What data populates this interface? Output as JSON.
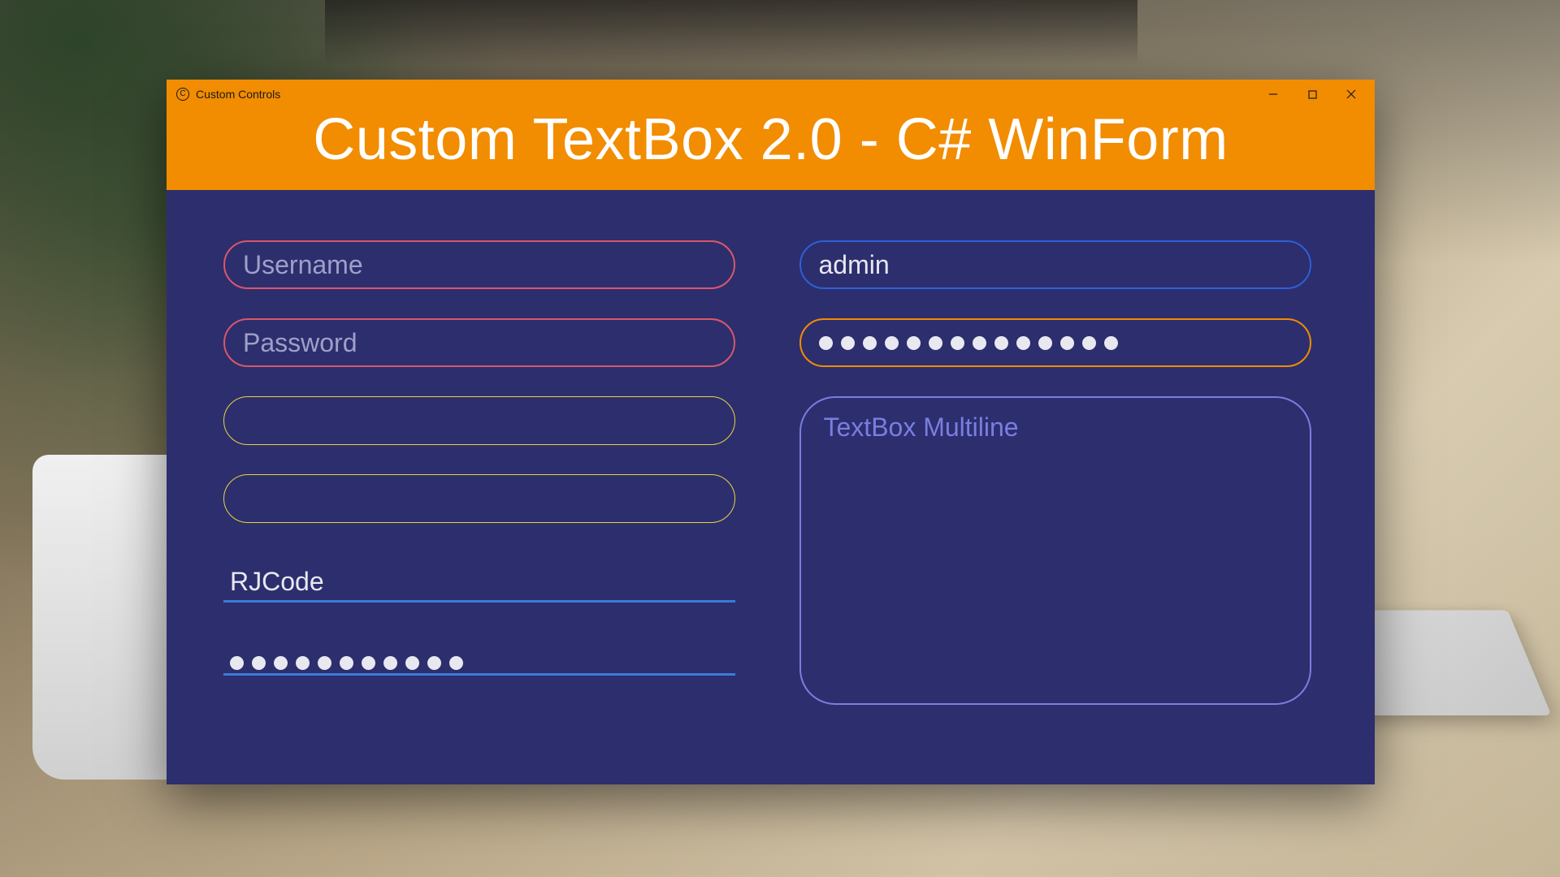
{
  "window": {
    "title": "Custom Controls",
    "header": "Custom TextBox 2.0 - C# WinForm"
  },
  "left": {
    "username_placeholder": "Username",
    "password_placeholder": "Password",
    "rjcode_value": "RJCode",
    "underline_password_dots": 11
  },
  "right": {
    "admin_value": "admin",
    "password_dots": 14,
    "multiline_placeholder": "TextBox Multiline"
  },
  "colors": {
    "accent_orange": "#f28c00",
    "panel_bg": "#2d2e6e",
    "border_red": "#d9576a",
    "border_blue": "#2e5fd8",
    "border_yellow": "#e6d540",
    "border_violet": "#7a7ee0",
    "underline_blue": "#3b7bd8"
  }
}
